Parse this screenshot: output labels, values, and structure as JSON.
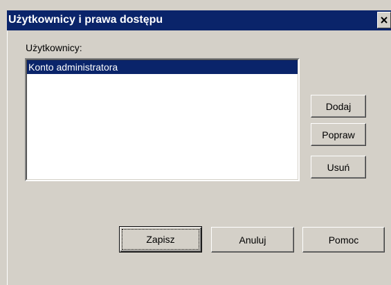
{
  "window": {
    "title": "Użytkownicy i prawa dostępu",
    "close_icon": "close-icon"
  },
  "users": {
    "label": "Użytkownicy:",
    "items": [
      {
        "name": "Konto administratora",
        "selected": true
      }
    ]
  },
  "side_buttons": {
    "add": "Dodaj",
    "edit": "Popraw",
    "delete": "Usuń"
  },
  "footer_buttons": {
    "save": "Zapisz",
    "cancel": "Anuluj",
    "help": "Pomoc"
  },
  "colors": {
    "titlebar": "#0a246a",
    "face": "#d4d0c8",
    "selection": "#0a246a"
  }
}
